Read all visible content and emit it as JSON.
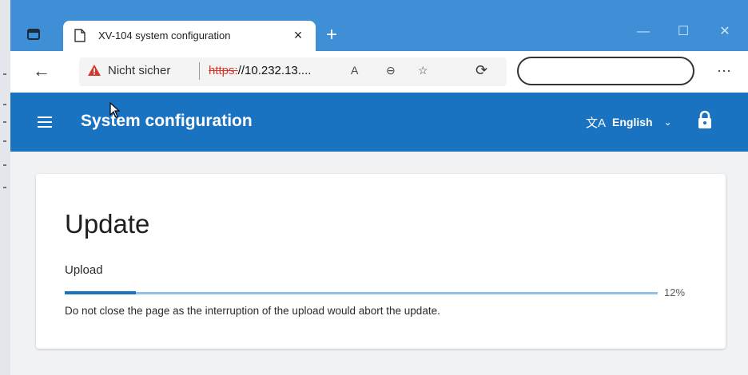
{
  "browser": {
    "tab_title": "XV-104 system configuration",
    "tab_close": "×",
    "new_tab": "+",
    "window_controls": {
      "minimize": "—",
      "maximize": "☐",
      "close": "✕"
    },
    "back": "←",
    "security_label": "Nicht sicher",
    "separator": "|",
    "url_scheme": "https:",
    "url_rest": "//10.232.13....",
    "read_aloud_icon": "A",
    "zoom_icon": "⊖",
    "favorite_icon": "☆",
    "extensions_icon": "⟳",
    "more_label": "···"
  },
  "app": {
    "title": "System configuration",
    "language": "English",
    "language_chevron": "⌄",
    "translate_icon": "文A"
  },
  "update": {
    "heading": "Update",
    "upload_label": "Upload",
    "progress_text": "12%",
    "progress_fraction": 0.12,
    "notice": "Do not close the page as the interruption of the upload would abort the update."
  },
  "colors": {
    "titlebar": "#3f8fd6",
    "appbar": "#1a73c0",
    "progress_fill": "#1a73c0",
    "progress_track": "#8ec1e7",
    "warning": "#d13a2a"
  }
}
